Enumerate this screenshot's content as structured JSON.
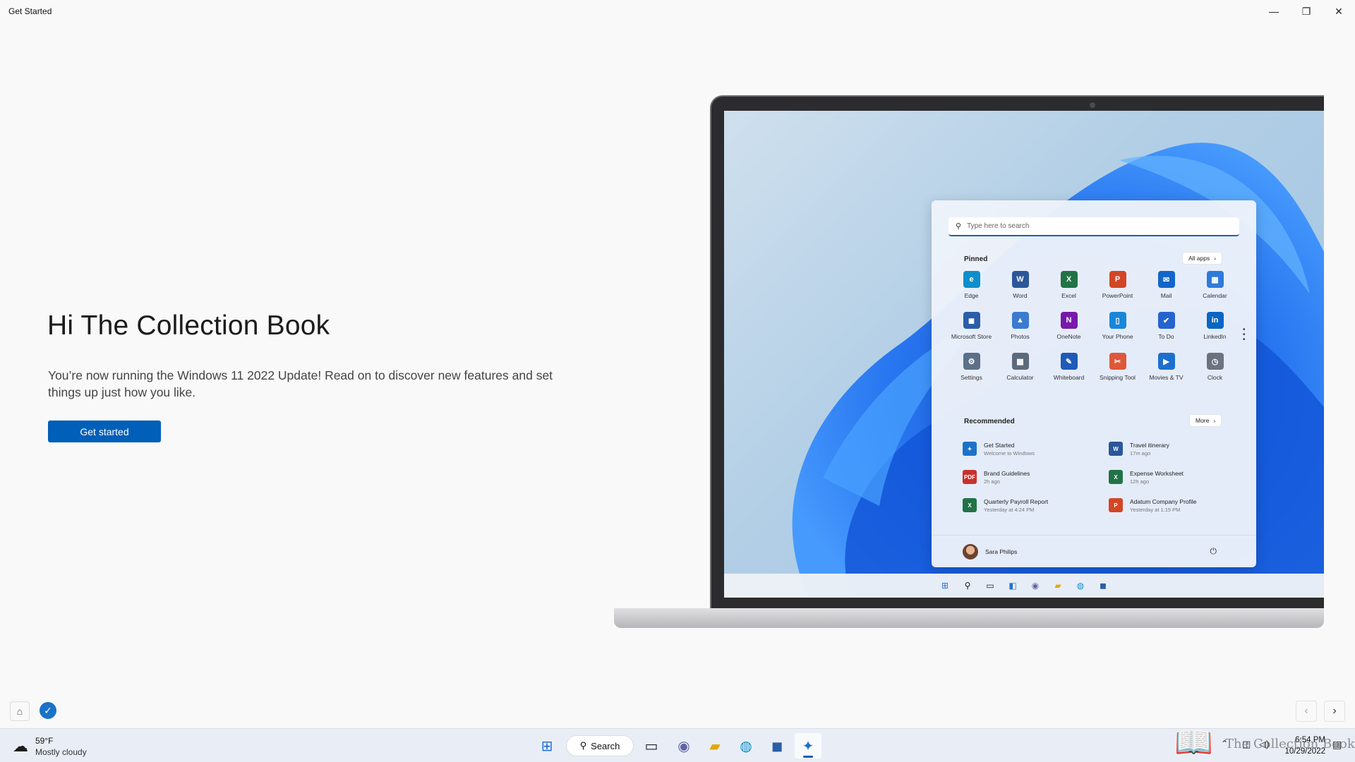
{
  "window": {
    "title": "Get Started"
  },
  "hero": {
    "title": "Hi The Collection Book",
    "body": "You’re now running the Windows 11 2022 Update! Read on to discover new features and set things up just how you like.",
    "cta": "Get started"
  },
  "start_menu": {
    "search_placeholder": "Type here to search",
    "pinned_label": "Pinned",
    "all_apps_label": "All apps",
    "pinned": [
      {
        "label": "Edge",
        "color": "#0f8fc9",
        "glyph": "e"
      },
      {
        "label": "Word",
        "color": "#2b579a",
        "glyph": "W"
      },
      {
        "label": "Excel",
        "color": "#217346",
        "glyph": "X"
      },
      {
        "label": "PowerPoint",
        "color": "#d24726",
        "glyph": "P"
      },
      {
        "label": "Mail",
        "color": "#1366c9",
        "glyph": "✉"
      },
      {
        "label": "Calendar",
        "color": "#2f7bd8",
        "glyph": "▦"
      },
      {
        "label": "Microsoft Store",
        "color": "#2a5ea8",
        "glyph": "◼"
      },
      {
        "label": "Photos",
        "color": "#3a7bd0",
        "glyph": "▲"
      },
      {
        "label": "OneNote",
        "color": "#7719aa",
        "glyph": "N"
      },
      {
        "label": "Your Phone",
        "color": "#1a86d8",
        "glyph": "▯"
      },
      {
        "label": "To Do",
        "color": "#2564cf",
        "glyph": "✔"
      },
      {
        "label": "LinkedIn",
        "color": "#0a66c2",
        "glyph": "in"
      },
      {
        "label": "Settings",
        "color": "#5c7189",
        "glyph": "⚙"
      },
      {
        "label": "Calculator",
        "color": "#5d6a7a",
        "glyph": "▦"
      },
      {
        "label": "Whiteboard",
        "color": "#1e5ab8",
        "glyph": "✎"
      },
      {
        "label": "Snipping Tool",
        "color": "#e0563b",
        "glyph": "✂"
      },
      {
        "label": "Movies & TV",
        "color": "#1d6fcf",
        "glyph": "▶"
      },
      {
        "label": "Clock",
        "color": "#6b7280",
        "glyph": "◷"
      }
    ],
    "recommended_label": "Recommended",
    "more_label": "More",
    "recommended": [
      {
        "name": "Get Started",
        "time": "Welcome to Windows",
        "color": "#1b73c9",
        "glyph": "✦"
      },
      {
        "name": "Travel itinerary",
        "time": "17m ago",
        "color": "#2b579a",
        "glyph": "W"
      },
      {
        "name": "Brand Guidelines",
        "time": "2h ago",
        "color": "#c8322c",
        "glyph": "PDF"
      },
      {
        "name": "Expense Worksheet",
        "time": "12h ago",
        "color": "#217346",
        "glyph": "X"
      },
      {
        "name": "Quarterly Payroll Report",
        "time": "Yesterday at 4:24 PM",
        "color": "#217346",
        "glyph": "X"
      },
      {
        "name": "Adatum Company Profile",
        "time": "Yesterday at 1:15 PM",
        "color": "#d24726",
        "glyph": "P"
      }
    ],
    "user": "Sara Philips"
  },
  "taskbar": {
    "weather_temp": "59°F",
    "weather_desc": "Mostly cloudy",
    "search_label": "Search",
    "time": "6:54 PM",
    "date": "10/29/2022"
  },
  "watermark": "The Collection Book",
  "colors": {
    "accent": "#005fb8",
    "taskbar": "#e9eef6"
  }
}
